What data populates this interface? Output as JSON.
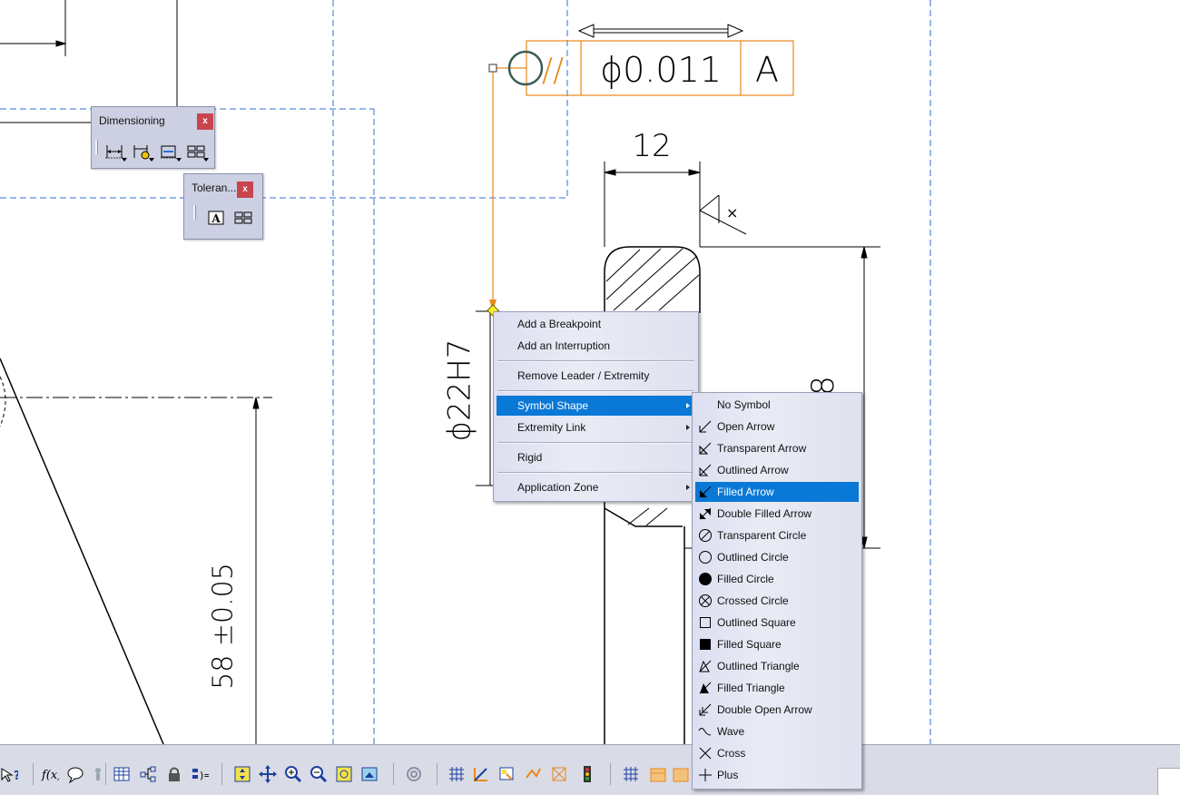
{
  "drawing": {
    "gdt_frame": {
      "symbol": "//",
      "tolerance": "ϕ0.011",
      "datum": "A"
    },
    "dim_width": "12",
    "dim_diameter": "ϕ22H7",
    "dim_height": "58 ±0.05",
    "dim_right_partial": "8",
    "roughness_mark": "×"
  },
  "toolbars": {
    "dimensioning": {
      "title": "Dimensioning",
      "close": "x"
    },
    "tolerancing": {
      "title": "Toleran...",
      "close": "x"
    }
  },
  "context_menu": {
    "items": [
      {
        "label": "Add a Breakpoint"
      },
      {
        "label": "Add an Interruption"
      },
      {
        "label": "Remove Leader / Extremity"
      },
      {
        "label": "Symbol Shape",
        "selected": true,
        "submenu": true
      },
      {
        "label": "Extremity Link",
        "submenu": true
      },
      {
        "label": "Rigid"
      },
      {
        "label": "Application Zone",
        "submenu": true
      }
    ]
  },
  "symbol_shape_menu": {
    "items": [
      {
        "label": "No Symbol",
        "icon": "no-symbol-icon"
      },
      {
        "label": "Open Arrow",
        "icon": "open-arrow-icon"
      },
      {
        "label": "Transparent Arrow",
        "icon": "transparent-arrow-icon"
      },
      {
        "label": "Outlined Arrow",
        "icon": "outlined-arrow-icon"
      },
      {
        "label": "Filled Arrow",
        "icon": "filled-arrow-icon",
        "selected": true
      },
      {
        "label": "Double Filled Arrow",
        "icon": "double-filled-arrow-icon"
      },
      {
        "label": "Transparent Circle",
        "icon": "transparent-circle-icon"
      },
      {
        "label": "Outlined Circle",
        "icon": "outlined-circle-icon"
      },
      {
        "label": "Filled Circle",
        "icon": "filled-circle-icon"
      },
      {
        "label": "Crossed Circle",
        "icon": "crossed-circle-icon"
      },
      {
        "label": "Outlined Square",
        "icon": "outlined-square-icon"
      },
      {
        "label": "Filled Square",
        "icon": "filled-square-icon"
      },
      {
        "label": "Outlined Triangle",
        "icon": "outlined-triangle-icon"
      },
      {
        "label": "Filled Triangle",
        "icon": "filled-triangle-icon"
      },
      {
        "label": "Double Open Arrow",
        "icon": "double-open-arrow-icon"
      },
      {
        "label": "Wave",
        "icon": "wave-icon"
      },
      {
        "label": "Cross",
        "icon": "cross-icon"
      },
      {
        "label": "Plus",
        "icon": "plus-icon"
      }
    ]
  },
  "colors": {
    "leader_orange": "#e8891c",
    "frame_blue_dashed": "#2f6fd6",
    "menu_highlight": "#0a78d6",
    "toolbar_bg": "#ccd0e2",
    "close_red": "#c9454d"
  }
}
